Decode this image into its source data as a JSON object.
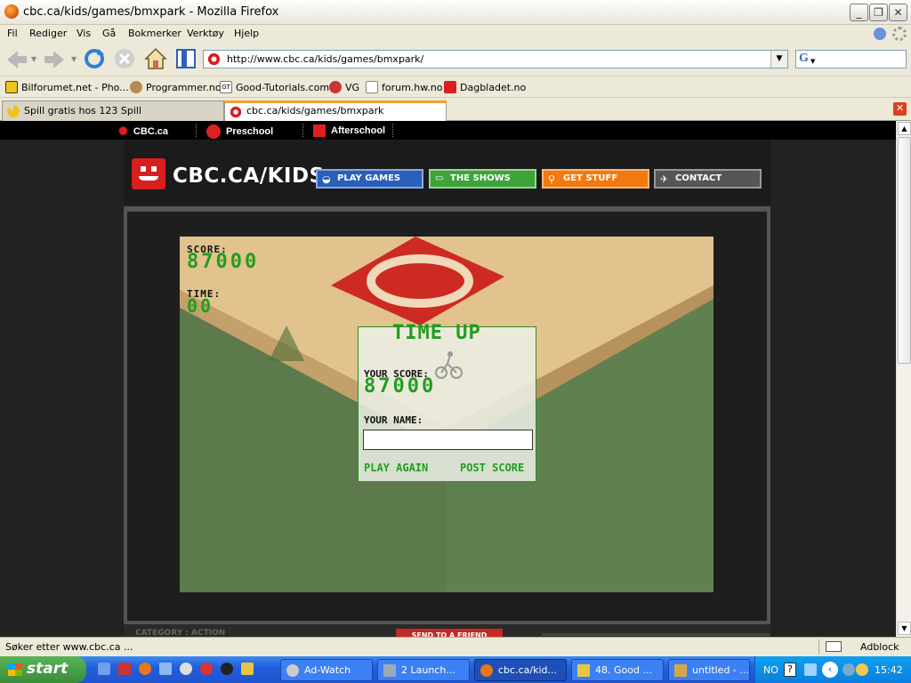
{
  "window": {
    "title": "cbc.ca/kids/games/bmxpark - Mozilla Firefox"
  },
  "menu": [
    "Fil",
    "Rediger",
    "Vis",
    "Gå",
    "Bokmerker",
    "Verktøy",
    "Hjelp"
  ],
  "address": {
    "url": "http://www.cbc.ca/kids/games/bmxpark/"
  },
  "bookmarks": [
    "Bilforumet.net - Pho...",
    "Programmer.no",
    "Good-Tutorials.com",
    "VG",
    "forum.hw.no",
    "Dagbladet.no"
  ],
  "tabs": [
    {
      "label": "Spill gratis hos 123 Spill",
      "active": false
    },
    {
      "label": "cbc.ca/kids/games/bmxpark",
      "active": true
    }
  ],
  "page": {
    "strip": [
      "CBC.ca",
      "Preschool",
      "Afterschool"
    ],
    "logo": "CBC.CA/KIDS",
    "nav": [
      "PLAY GAMES",
      "THE SHOWS",
      "GET STUFF",
      "CONTACT"
    ],
    "game": {
      "score_label": "SCORE:",
      "score": "87000",
      "time_label": "TIME:",
      "time": "00",
      "dialog_title": "TIME UP",
      "your_score_label": "YOUR SCORE:",
      "your_score": "87000",
      "your_name_label": "YOUR NAME:",
      "play_again": "PLAY AGAIN",
      "post_score": "POST SCORE"
    },
    "category": "CATEGORY : ACTION",
    "send_friend": "SEND TO A FRIEND"
  },
  "status": {
    "text": "Søker etter www.cbc.ca ...",
    "adblock": "Adblock"
  },
  "taskbar": {
    "start": "start",
    "tasks": [
      "Ad-Watch",
      "2 Launch...",
      "cbc.ca/kid...",
      "48. Good ...",
      "untitled - ..."
    ],
    "lang": "NO",
    "clock": "15:42"
  },
  "colors": {
    "cbc_red": "#d81e1e",
    "game_green": "#1f9e1f",
    "play_blue": "#2a5fb8",
    "shows_green": "#3fa33a",
    "stuff_orange": "#f07a10",
    "contact_grey": "#555555"
  }
}
